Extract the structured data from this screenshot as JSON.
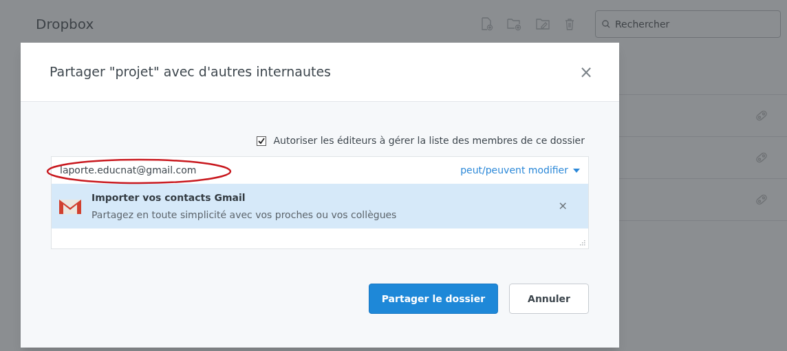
{
  "app": {
    "title": "Dropbox",
    "search": {
      "placeholder": "Rechercher"
    }
  },
  "dialog": {
    "title": "Partager \"projet\" avec d'autres internautes",
    "close": "×",
    "option": {
      "label": "Autoriser les éditeurs à gérer la liste des membres de ce dossier",
      "checked": true
    },
    "recipient": {
      "value": "laporte.educnat@gmail.com",
      "highlighted": true
    },
    "permission": "peut/peuvent modifier",
    "banner": {
      "title": "Importer vos contacts Gmail",
      "text": "Partagez en toute simplicité avec vos proches ou vos collègues",
      "dismiss": "✕"
    },
    "buttons": [
      {
        "label": "Partager le dossier",
        "kind": "primary"
      },
      {
        "label": "Annuler",
        "kind": "secondary"
      }
    ]
  }
}
